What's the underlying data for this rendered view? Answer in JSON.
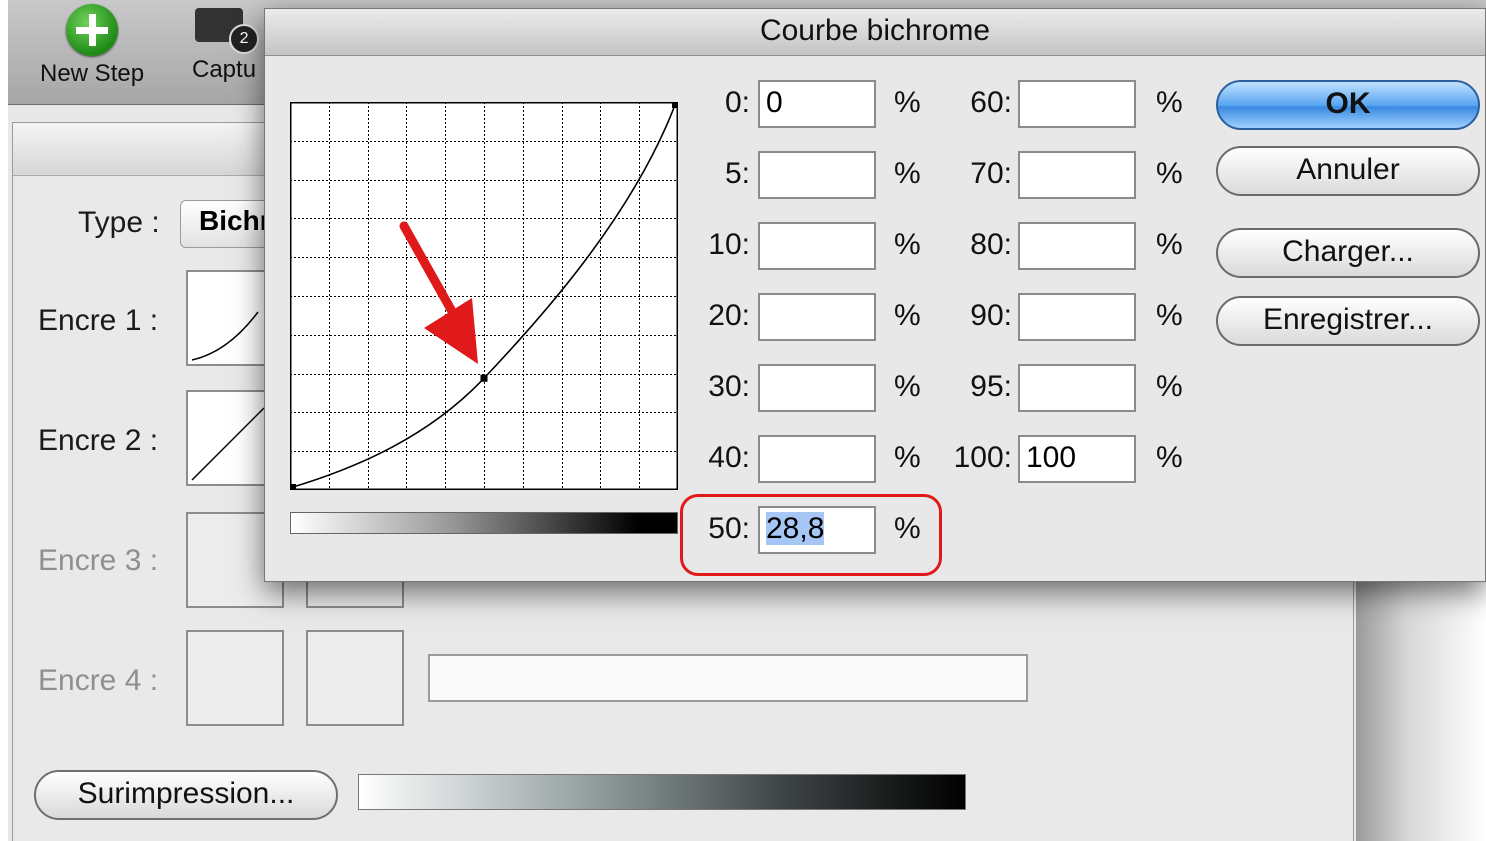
{
  "app": {
    "toolbar": {
      "new_step": "New Step",
      "capture": "Captu",
      "capture_badge": "2"
    },
    "type_label": "Type :",
    "type_value": "Bichr",
    "inks": [
      "Encre 1 :",
      "Encre 2 :",
      "Encre 3 :",
      "Encre 4 :"
    ],
    "overprint_button": "Surimpression..."
  },
  "dialog": {
    "title": "Courbe bichrome",
    "curve_selected_point": {
      "input": 50,
      "output": 28.8
    },
    "left_fields": [
      {
        "label": "0:",
        "value": "0"
      },
      {
        "label": "5:",
        "value": ""
      },
      {
        "label": "10:",
        "value": ""
      },
      {
        "label": "20:",
        "value": ""
      },
      {
        "label": "30:",
        "value": ""
      },
      {
        "label": "40:",
        "value": ""
      },
      {
        "label": "50:",
        "value": "28,8"
      }
    ],
    "right_fields": [
      {
        "label": "60:",
        "value": ""
      },
      {
        "label": "70:",
        "value": ""
      },
      {
        "label": "80:",
        "value": ""
      },
      {
        "label": "90:",
        "value": ""
      },
      {
        "label": "95:",
        "value": ""
      },
      {
        "label": "100:",
        "value": "100"
      }
    ],
    "percent": "%",
    "buttons": {
      "ok": "OK",
      "cancel": "Annuler",
      "load": "Charger...",
      "save": "Enregistrer..."
    },
    "accent": "#e01a1a",
    "default_button_color": "#3b8ae0"
  }
}
